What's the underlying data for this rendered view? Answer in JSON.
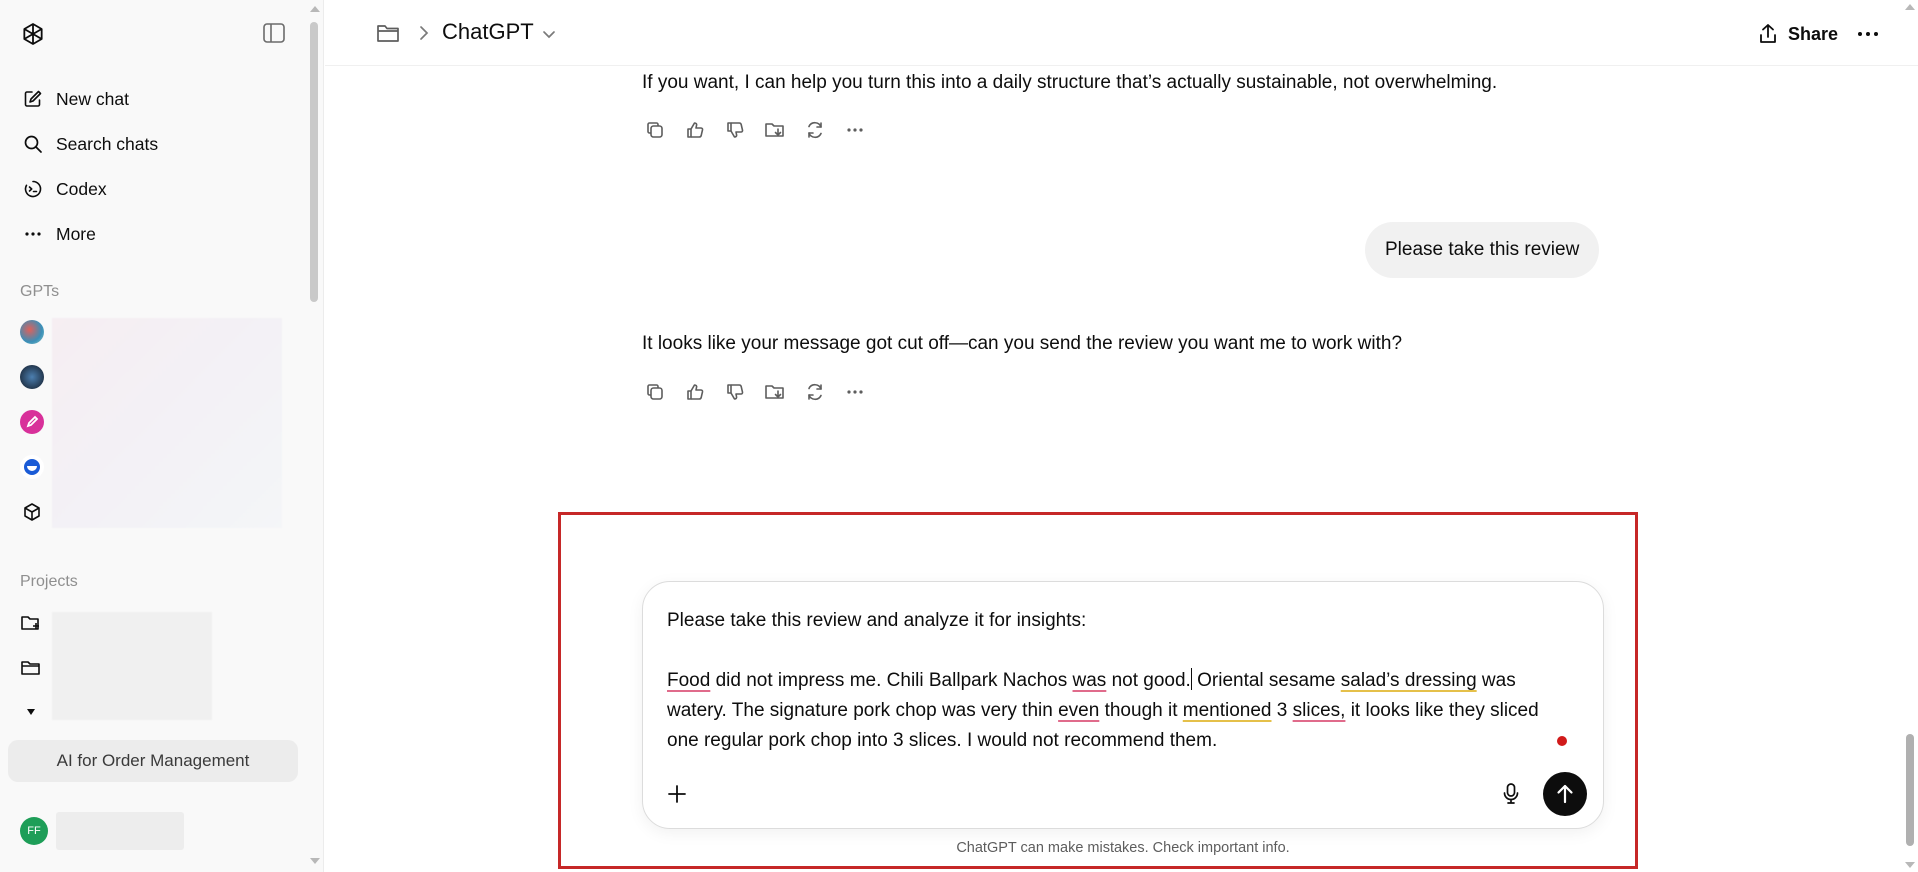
{
  "sidebar": {
    "nav": [
      {
        "label": "New chat",
        "icon": "new-chat-icon"
      },
      {
        "label": "Search chats",
        "icon": "search-icon"
      },
      {
        "label": "Codex",
        "icon": "codex-icon"
      },
      {
        "label": "More",
        "icon": "more-dots-icon"
      }
    ],
    "gpts_label": "GPTs",
    "projects_label": "Projects",
    "pinned_item": "AI for Order Management",
    "user_initials": "FF"
  },
  "header": {
    "model_name": "ChatGPT",
    "share_label": "Share"
  },
  "conversation": {
    "assistant_message_1": "If you want, I can help you turn this into a daily structure that’s actually sustainable, not overwhelming.",
    "user_message": "Please take this review",
    "assistant_message_2": "It looks like your message got cut off—can you send the review you want me to work with?"
  },
  "composer": {
    "line1": "Please take this review and analyze it for insights:",
    "review": {
      "w_food": "Food",
      "t1": " did not impress me. Chili Ballpark Nachos ",
      "w_was": "was",
      "t2": " not good.",
      "t3": " Oriental sesame ",
      "w_salads": "salad’s dressing",
      "t4": " was watery. The signature pork chop was very thin ",
      "w_even": "even",
      "t5": " though it ",
      "w_mentioned": "mentioned",
      "t6": " 3 ",
      "w_slices": "slices,",
      "t7": " it looks like they sliced one regular pork chop into 3 slices. I would not recommend them."
    }
  },
  "disclaimer": "ChatGPT can make mistakes. Check important info.",
  "colors": {
    "highlight_border": "#c62828",
    "send_button": "#0d0d0d",
    "recording_dot": "#d11a1a",
    "user_avatar": "#1e9e58"
  }
}
